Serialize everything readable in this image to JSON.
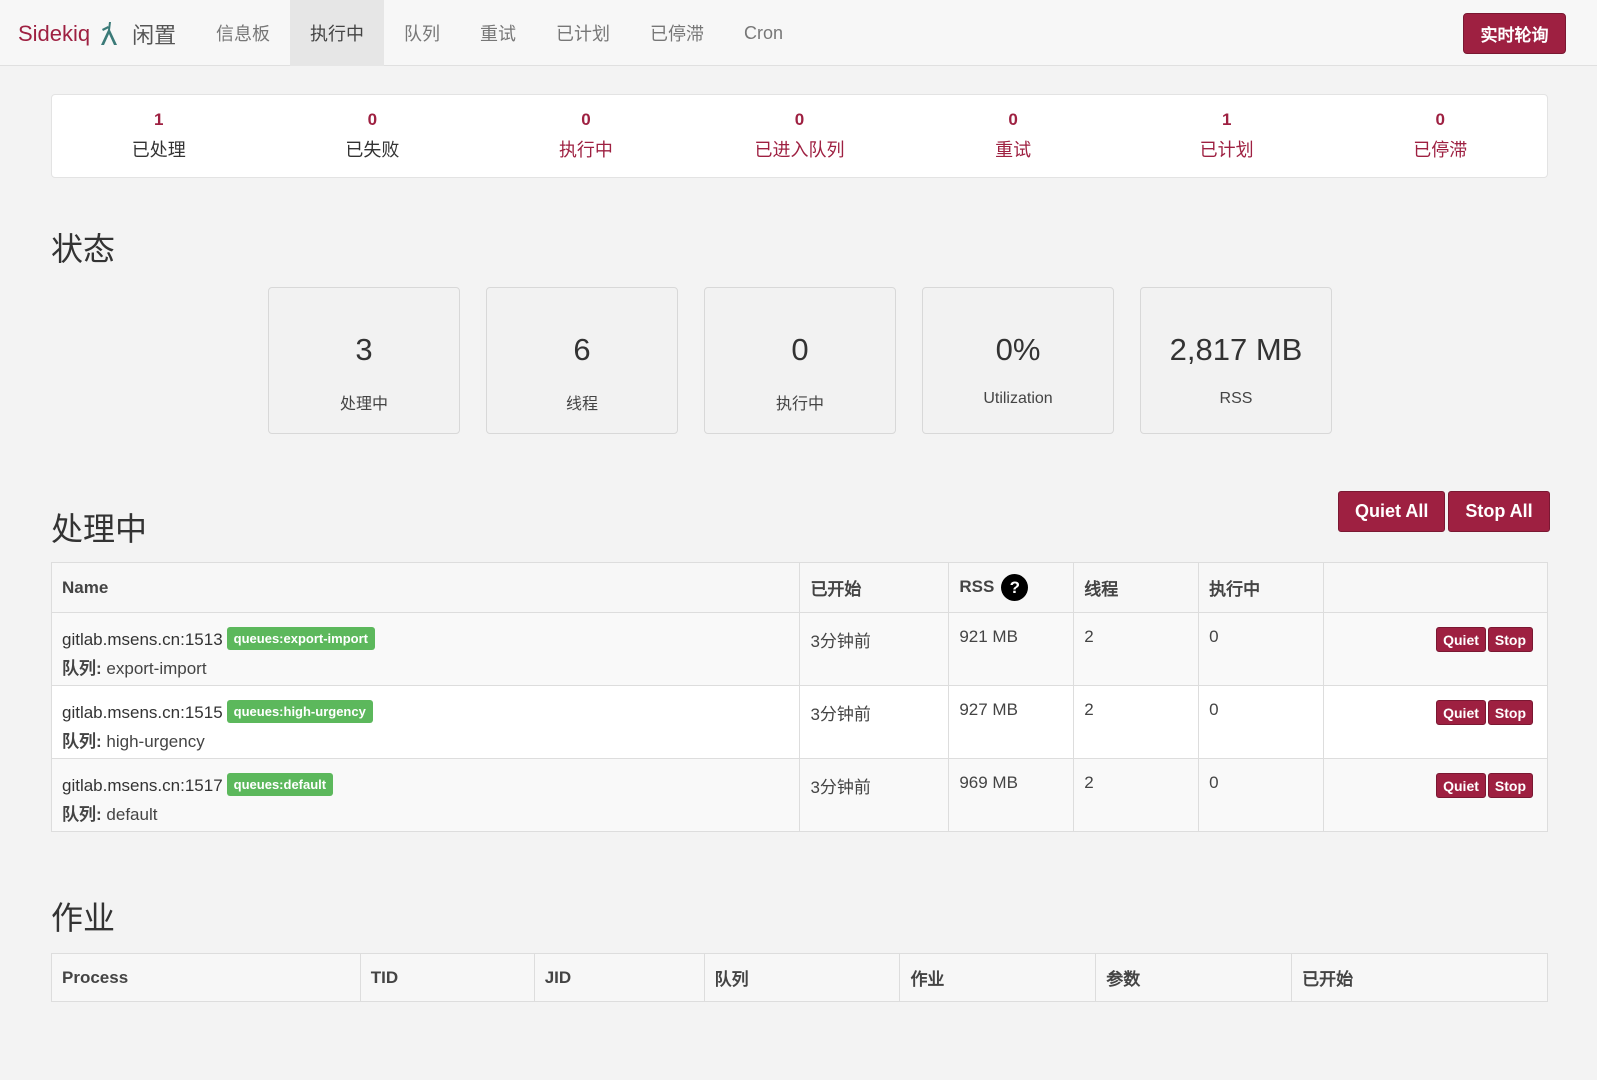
{
  "navbar": {
    "brand": "Sidekiq",
    "status": "闲置",
    "items": [
      {
        "label": "信息板",
        "active": false
      },
      {
        "label": "执行中",
        "active": true
      },
      {
        "label": "队列",
        "active": false
      },
      {
        "label": "重试",
        "active": false
      },
      {
        "label": "已计划",
        "active": false
      },
      {
        "label": "已停滞",
        "active": false
      },
      {
        "label": "Cron",
        "active": false
      }
    ],
    "live_poll_label": "实时轮询",
    "brand_color": "#9e2041"
  },
  "summary": [
    {
      "count": "1",
      "label": "已处理"
    },
    {
      "count": "0",
      "label": "已失败"
    },
    {
      "count": "0",
      "label": "执行中"
    },
    {
      "count": "0",
      "label": "已进入队列"
    },
    {
      "count": "0",
      "label": "重试"
    },
    {
      "count": "1",
      "label": "已计划"
    },
    {
      "count": "0",
      "label": "已停滞"
    }
  ],
  "status_section": {
    "title": "状态",
    "stats": [
      {
        "value": "3",
        "label": "处理中"
      },
      {
        "value": "6",
        "label": "线程"
      },
      {
        "value": "0",
        "label": "执行中"
      },
      {
        "value": "0%",
        "label": "Utilization"
      },
      {
        "value": "2,817 MB",
        "label": "RSS"
      }
    ]
  },
  "processes_section": {
    "title": "处理中",
    "quiet_all_label": "Quiet All",
    "stop_all_label": "Stop All",
    "headers": {
      "name": "Name",
      "started": "已开始",
      "rss": "RSS",
      "rss_help": "?",
      "threads": "线程",
      "busy": "执行中"
    },
    "queue_key": "队列:",
    "quiet_label": "Quiet",
    "stop_label": "Stop",
    "rows": [
      {
        "host": "gitlab.msens.cn:1513",
        "tag": "queues:export-import",
        "queue": "export-import",
        "started": "3分钟前",
        "rss": "921 MB",
        "threads": "2",
        "busy": "0"
      },
      {
        "host": "gitlab.msens.cn:1515",
        "tag": "queues:high-urgency",
        "queue": "high-urgency",
        "started": "3分钟前",
        "rss": "927 MB",
        "threads": "2",
        "busy": "0"
      },
      {
        "host": "gitlab.msens.cn:1517",
        "tag": "queues:default",
        "queue": "default",
        "started": "3分钟前",
        "rss": "969 MB",
        "threads": "2",
        "busy": "0"
      }
    ]
  },
  "jobs_section": {
    "title": "作业",
    "headers": [
      "Process",
      "TID",
      "JID",
      "队列",
      "作业",
      "参数",
      "已开始"
    ]
  }
}
